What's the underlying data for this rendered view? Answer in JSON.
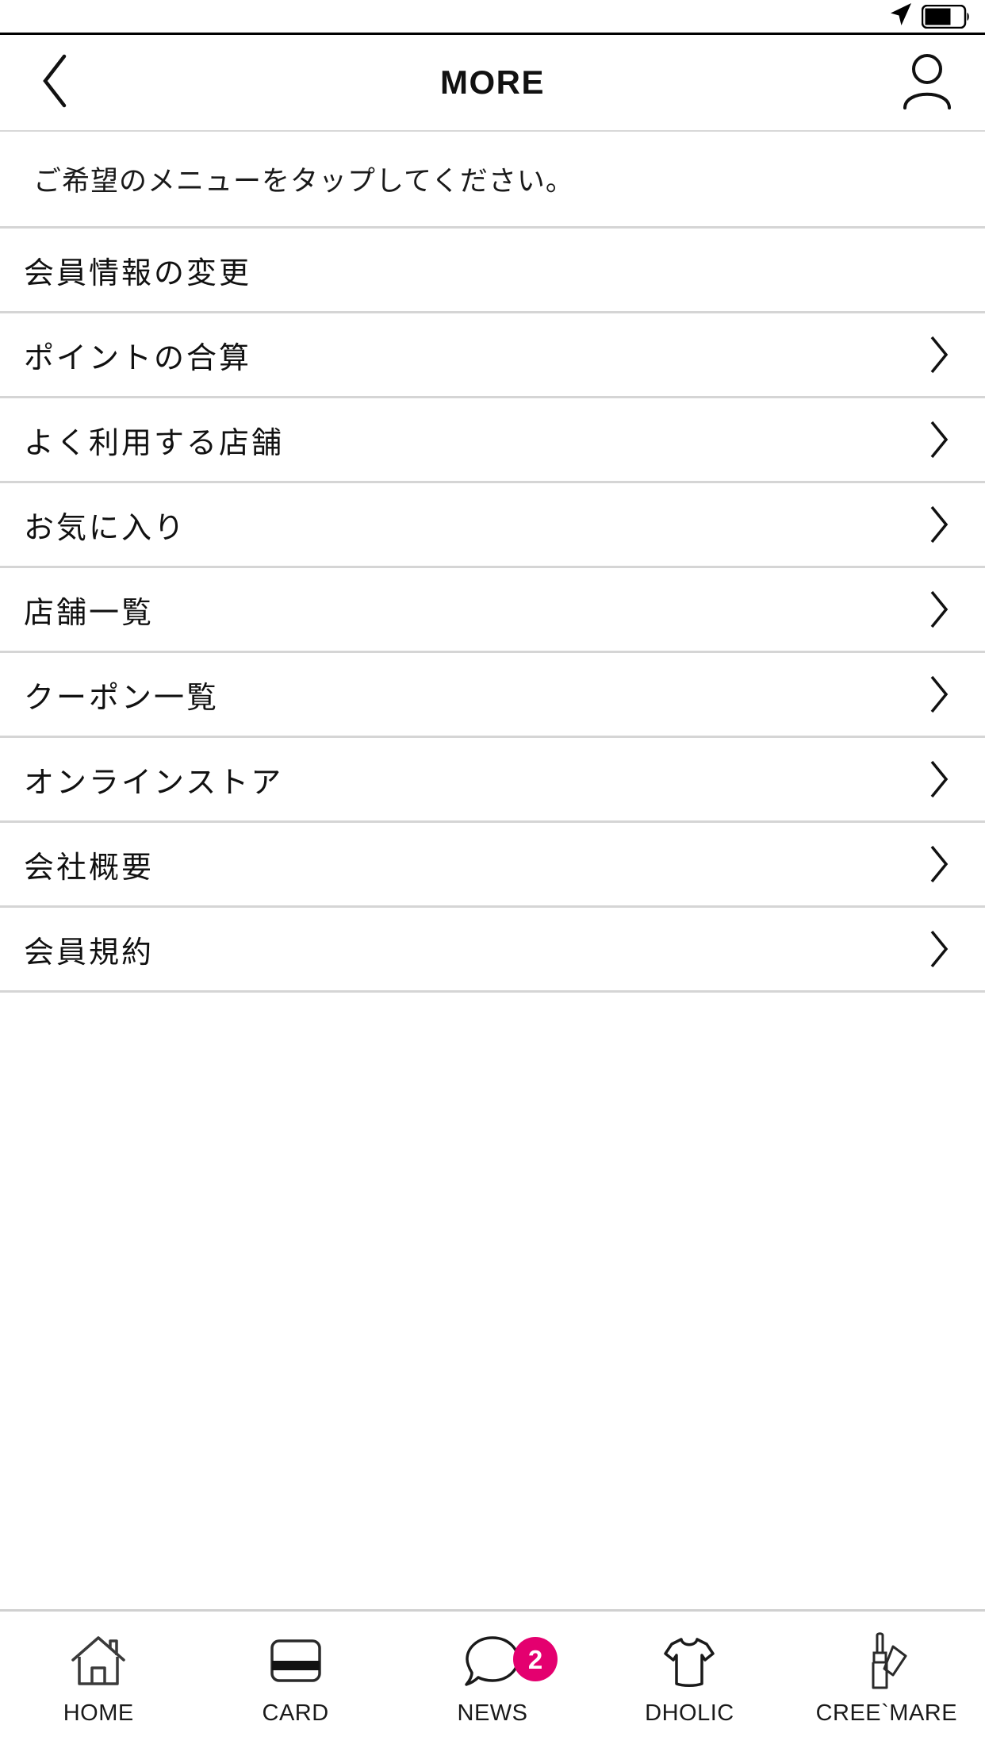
{
  "statusbar": {
    "location_icon": "location-arrow-icon",
    "battery_icon": "battery-icon",
    "battery_level_percent": 62
  },
  "header": {
    "title": "MORE",
    "back_icon": "chevron-left-icon",
    "profile_icon": "person-icon"
  },
  "instruction": {
    "text": "ご希望のメニューをタップしてください。"
  },
  "menu": {
    "items": [
      {
        "label": "会員情報の変更",
        "chevron": false
      },
      {
        "label": "ポイントの合算",
        "chevron": true
      },
      {
        "label": "よく利用する店舗",
        "chevron": true
      },
      {
        "label": "お気に入り",
        "chevron": true
      },
      {
        "label": "店舗一覧",
        "chevron": true
      },
      {
        "label": "クーポン一覧",
        "chevron": true
      },
      {
        "label": "オンラインストア",
        "chevron": true
      },
      {
        "label": "会社概要",
        "chevron": true
      },
      {
        "label": "会員規約",
        "chevron": true
      }
    ]
  },
  "tabbar": {
    "items": [
      {
        "label": "HOME",
        "icon": "home-icon",
        "badge": null
      },
      {
        "label": "CARD",
        "icon": "credit-card-icon",
        "badge": null
      },
      {
        "label": "NEWS",
        "icon": "speech-bubble-icon",
        "badge": "2"
      },
      {
        "label": "DHOLIC",
        "icon": "tshirt-icon",
        "badge": null
      },
      {
        "label": "CREE`MARE",
        "icon": "lipstick-icon",
        "badge": null
      }
    ]
  },
  "colors": {
    "badge": "#E4006F",
    "divider": "#d5d5d5",
    "text": "#111111",
    "background": "#ffffff"
  }
}
